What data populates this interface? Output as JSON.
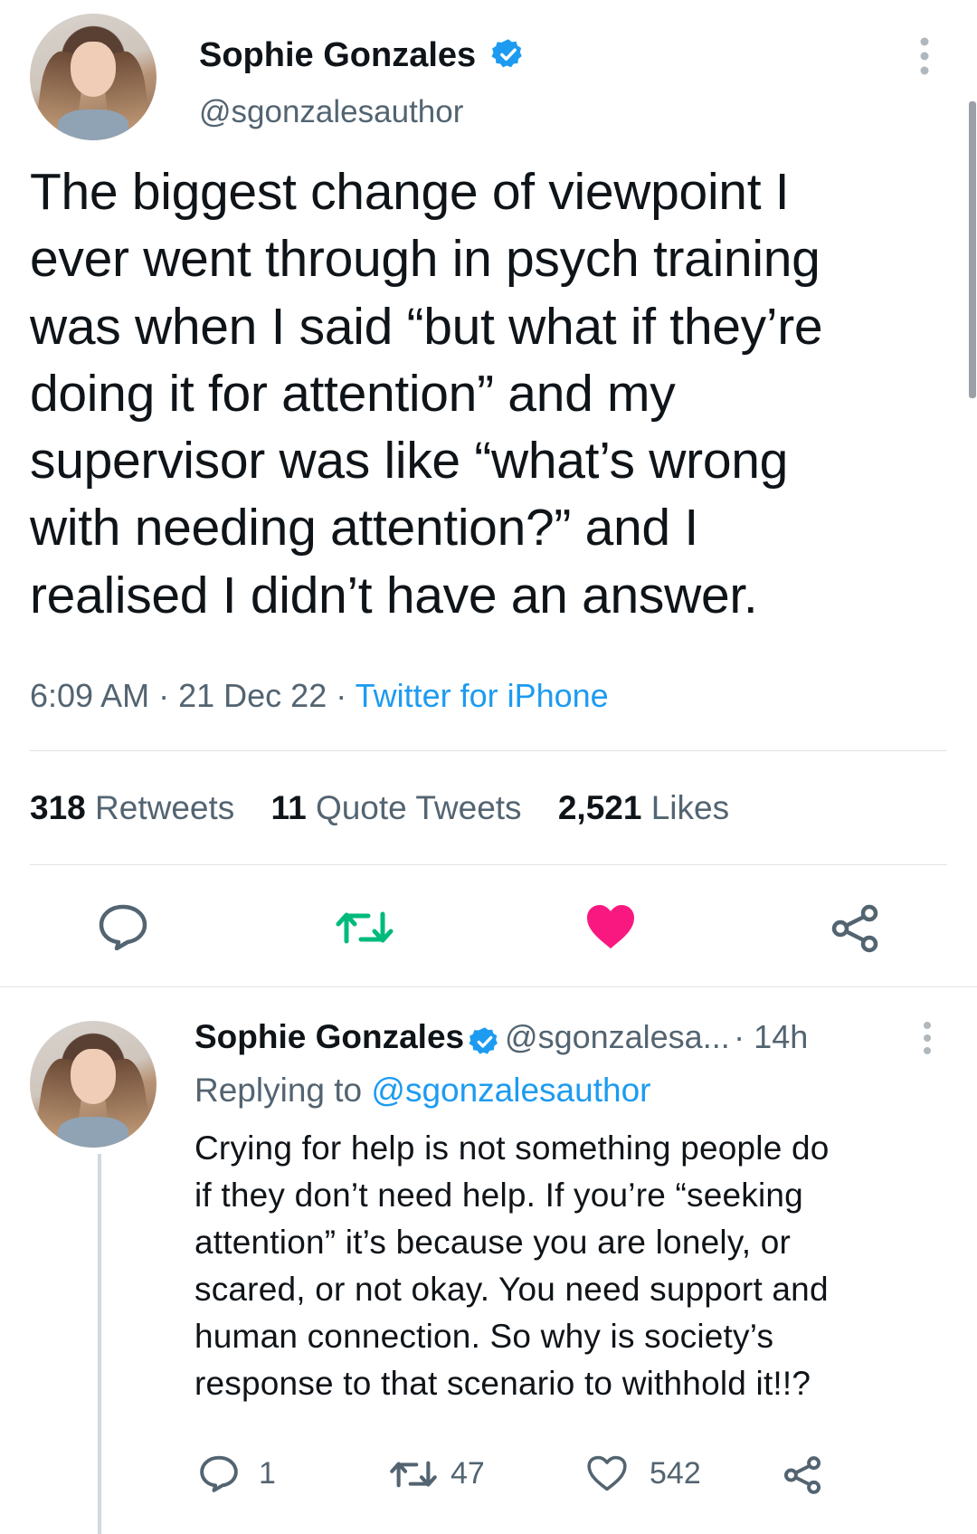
{
  "tweet": {
    "author_name": "Sophie Gonzales",
    "author_handle": "@sgonzalesauthor",
    "lines": [
      "The biggest change of viewpoint I",
      "ever went through in psych training",
      "was when I said “but what if they’re",
      "doing it for attention” and my",
      "supervisor was like “what’s wrong",
      "with needing attention?” and I",
      "realised I didn’t have an answer."
    ],
    "time": "6:09 AM",
    "date": "21 Dec 22",
    "source": "Twitter for iPhone",
    "retweets_count": "318",
    "retweets_label": "Retweets",
    "quotes_count": "11",
    "quotes_label": "Quote Tweets",
    "likes_count": "2,521",
    "likes_label": "Likes",
    "liked": true
  },
  "reply": {
    "author_name": "Sophie Gonzales",
    "author_handle": "@sgonzalesa...",
    "age": "14h",
    "replying_prefix": "Replying to",
    "replying_to": "@sgonzalesauthor",
    "lines": [
      "Crying for help is not something people do",
      "if they don’t need help. If you’re “seeking",
      "attention” it’s because you are lonely, or",
      "scared, or not okay. You need support and",
      "human connection. So why is society’s",
      "response to that scenario to withhold it!!?"
    ],
    "reply_count": "1",
    "retweet_count": "47",
    "like_count": "542"
  },
  "colors": {
    "accent": "#1d9bf0",
    "retweet_green": "#00ba7c",
    "like_pink": "#f91880",
    "secondary_text": "#536471"
  },
  "icons": [
    "verified-badge-icon",
    "more-icon",
    "reply-icon",
    "retweet-icon",
    "like-icon",
    "share-icon"
  ]
}
